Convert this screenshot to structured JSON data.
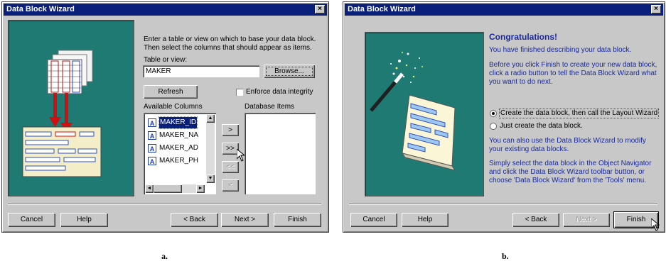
{
  "a": {
    "title": "Data Block Wizard",
    "close": "×",
    "instructions": "Enter a table or view on which to base your data block. Then select the columns that should appear as items.",
    "table_label": "Table or view:",
    "table_value": "MAKER",
    "browse": "Browse...",
    "refresh": "Refresh",
    "enforce": "Enforce data integrity",
    "available_label": "Available Columns",
    "database_label": "Database Items",
    "columns": [
      "MAKER_ID",
      "MAKER_NA",
      "MAKER_AD",
      "MAKER_PH"
    ],
    "move_buttons": [
      ">",
      ">>",
      "<<",
      "<"
    ],
    "buttons": {
      "cancel": "Cancel",
      "help": "Help",
      "back": "< Back",
      "next": "Next >",
      "finish": "Finish"
    }
  },
  "b": {
    "title": "Data Block Wizard",
    "close": "×",
    "heading": "Congratulations!",
    "p1": "You have finished describing your data block.",
    "p2": "Before you click Finish to create your new data block, click a radio button to tell the Data Block Wizard what you want to do next.",
    "radio1": "Create the data block, then call the Layout Wizard",
    "radio2": "Just create the data block.",
    "p3": "You can also use the Data Block Wizard to modify your existing data blocks.",
    "p4": "Simply select the data block in the Object Navigator and click the Data Block Wizard toolbar button, or choose 'Data Block Wizard' from the 'Tools' menu.",
    "buttons": {
      "cancel": "Cancel",
      "help": "Help",
      "back": "< Back",
      "next": "Next >",
      "finish": "Finish"
    }
  },
  "captions": {
    "a": "a.",
    "b": "b."
  },
  "colors": {
    "title_bar": "#0a1f7a",
    "panel": "#1e7a72",
    "face": "#c8c8c8"
  }
}
